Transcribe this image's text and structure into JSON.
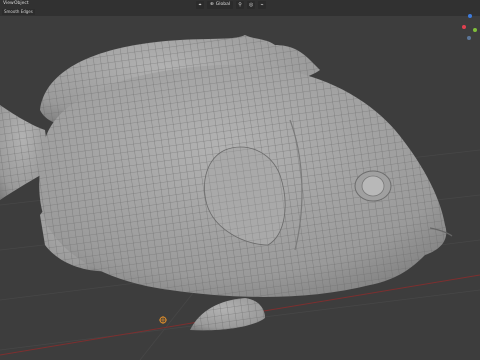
{
  "header": {
    "menu_view": "View",
    "menu_object": "Object",
    "submenu_label": "Smooth Edges",
    "shading_label": "Global"
  },
  "toolbar": {
    "icons": [
      "cursor-icon",
      "global-orientation-icon",
      "snap-icon",
      "proportional-edit-icon",
      "overlay-icon"
    ]
  },
  "gizmo": {
    "x_color": "#e0404f",
    "y_color": "#7fbf3a",
    "z_color": "#3d7bdb"
  },
  "colors": {
    "background": "#3d3d3d",
    "mesh": "#9d9d9d",
    "wire": "#6f6f6f",
    "red_axis": "#8a3232",
    "origin": "#d98a2b"
  }
}
